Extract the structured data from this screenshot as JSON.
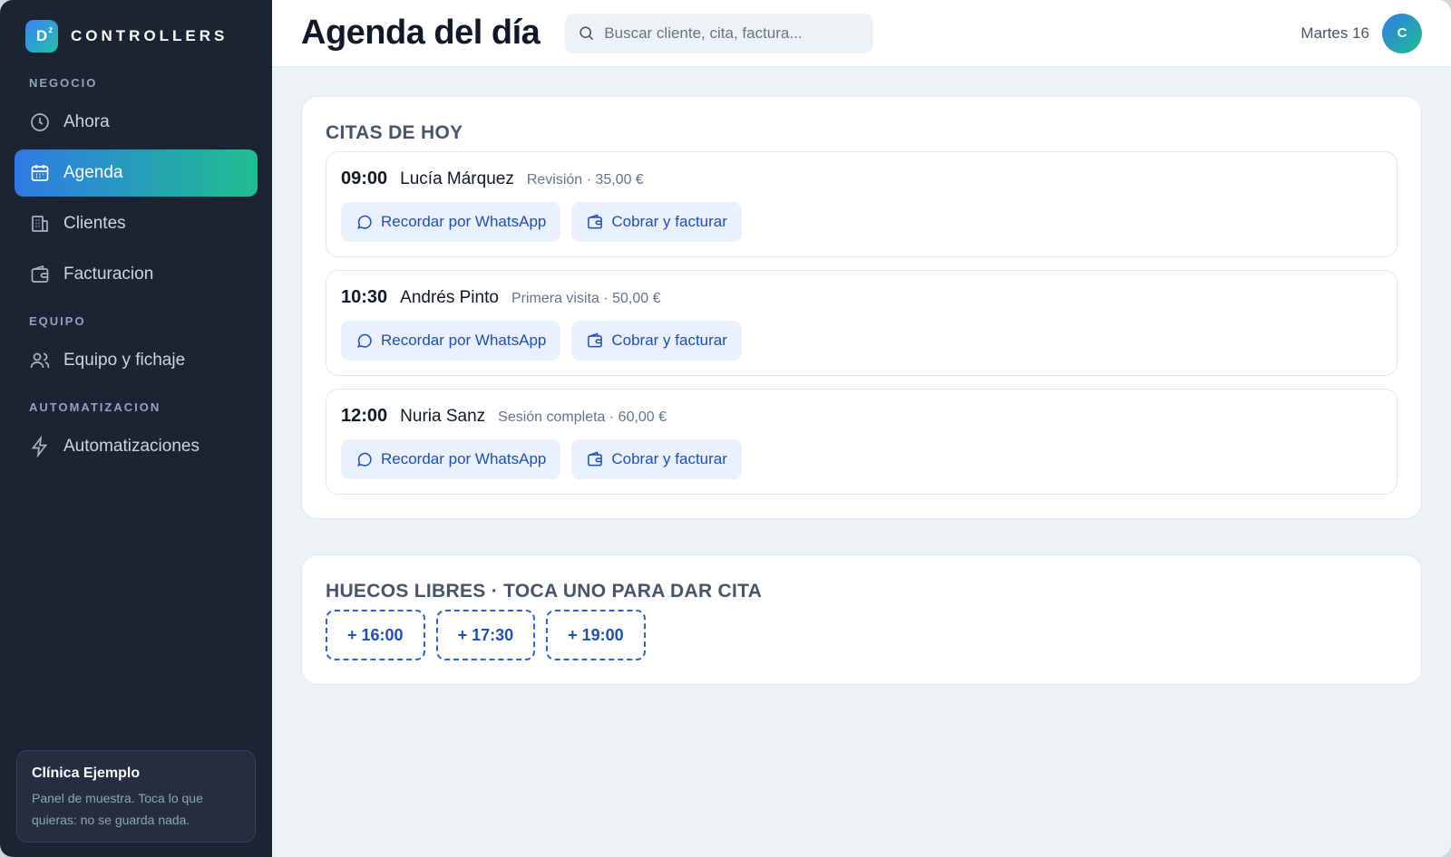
{
  "brand": {
    "logo_text": "D",
    "logo_sup": "2",
    "name": "CONTROLLERS"
  },
  "sidebar": {
    "sections": [
      {
        "label": "NEGOCIO"
      },
      {
        "label": "EQUIPO"
      },
      {
        "label": "AUTOMATIZACION"
      }
    ],
    "items": [
      {
        "label": "Ahora",
        "icon": "clock-icon"
      },
      {
        "label": "Agenda",
        "icon": "calendar-icon",
        "active": true
      },
      {
        "label": "Clientes",
        "icon": "building-icon"
      },
      {
        "label": "Facturacion",
        "icon": "wallet-icon"
      },
      {
        "label": "Equipo y fichaje",
        "icon": "users-icon"
      },
      {
        "label": "Automatizaciones",
        "icon": "bolt-icon"
      }
    ],
    "clinic": {
      "name": "Clínica Ejemplo",
      "description": "Panel de muestra. Toca lo que quieras: no se guarda nada."
    }
  },
  "header": {
    "title": "Agenda del día",
    "search_placeholder": "Buscar cliente, cita, factura...",
    "date": "Martes 16",
    "avatar_initial": "C"
  },
  "appointments": {
    "title": "CITAS DE HOY",
    "items": [
      {
        "time": "09:00",
        "name": "Lucía Márquez",
        "meta": "Revisión · 35,00 €"
      },
      {
        "time": "10:30",
        "name": "Andrés Pinto",
        "meta": "Primera visita · 50,00 €"
      },
      {
        "time": "12:00",
        "name": "Nuria Sanz",
        "meta": "Sesión completa · 60,00 €"
      }
    ],
    "remind_label": "Recordar por WhatsApp",
    "charge_label": "Cobrar y facturar"
  },
  "slots": {
    "title": "HUECOS LIBRES · TOCA UNO PARA DAR CITA",
    "items": [
      "+ 16:00",
      "+ 17:30",
      "+ 19:00"
    ]
  },
  "colors": {
    "sidebar_bg": "#1c2433",
    "accent_start": "#2f7ae5",
    "accent_end": "#1fbf8f",
    "action_text": "#1d4fb8"
  }
}
